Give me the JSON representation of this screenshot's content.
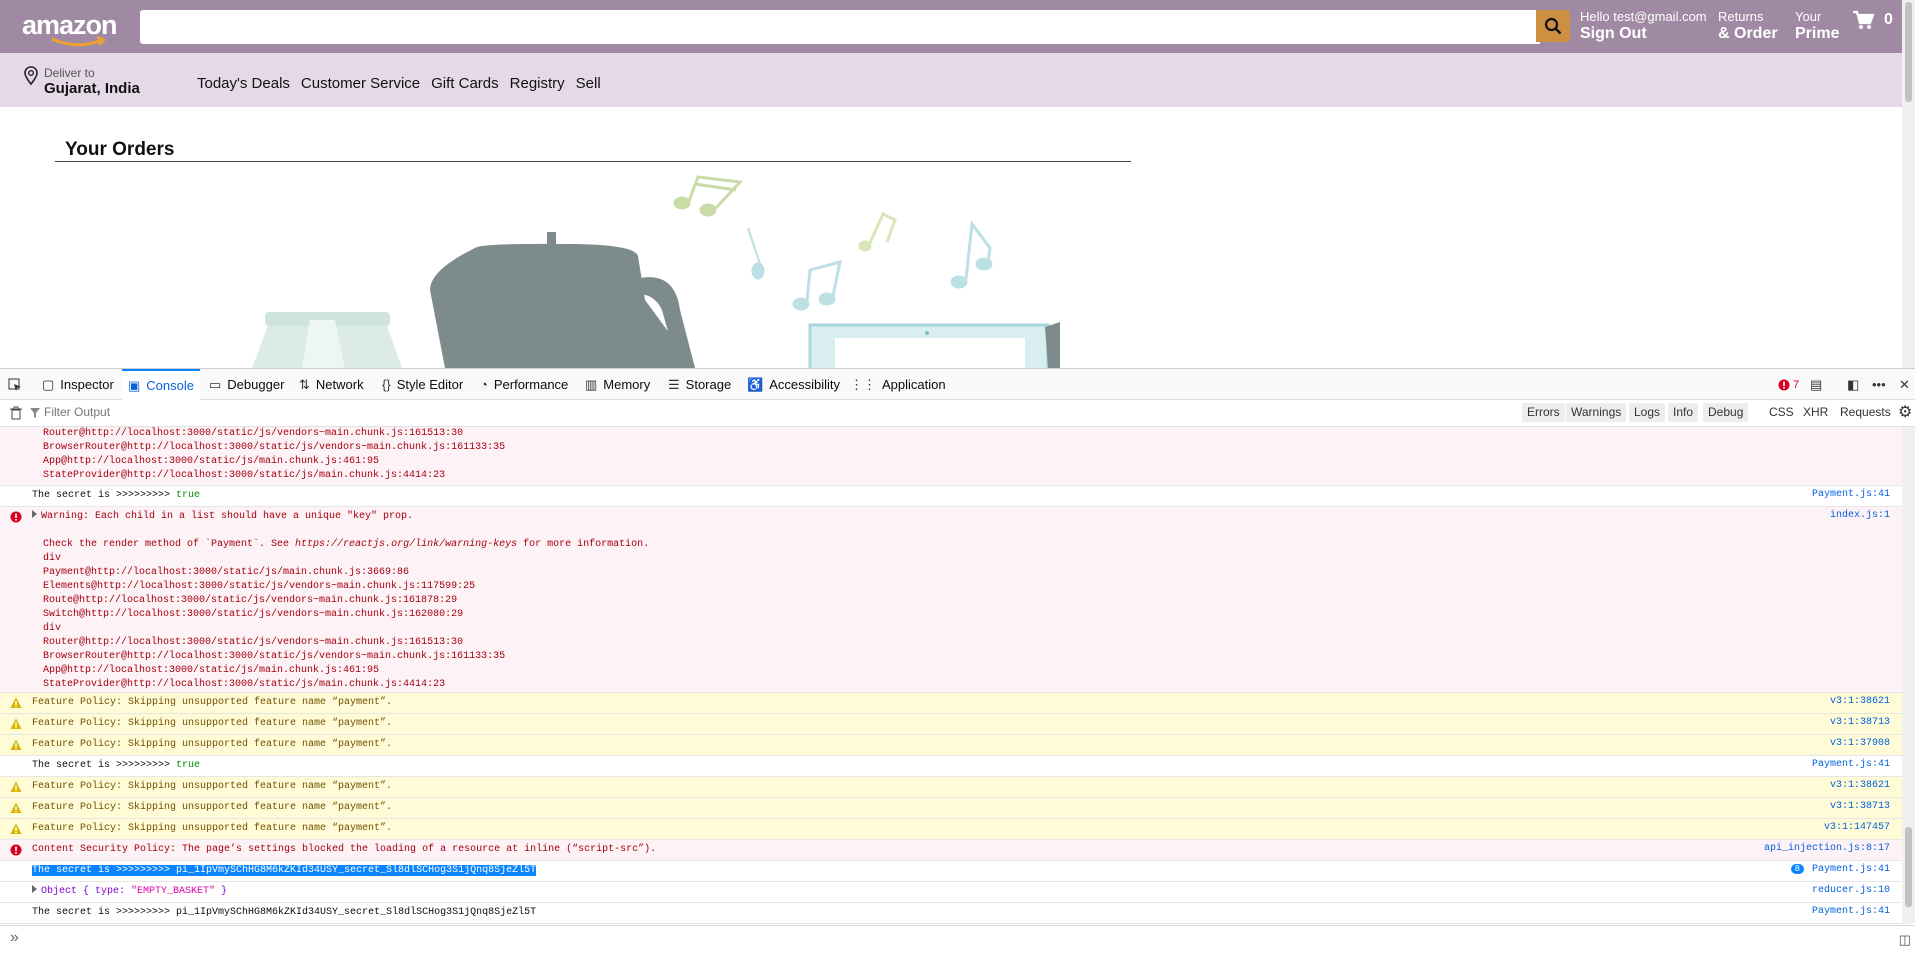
{
  "header": {
    "logo": "amazon",
    "search_placeholder": "",
    "greeting": "Hello test@gmail.com",
    "sign_out": "Sign Out",
    "returns_l1": "Returns",
    "returns_l2": "& Order",
    "prime_l1": "Your",
    "prime_l2": "Prime",
    "cart_count": "0",
    "colors": {
      "header_bg": "#a08aa3",
      "search_button": "#cd9042",
      "subnav_bg": "#e5d9e8"
    }
  },
  "subnav": {
    "deliver_l1": "Deliver to",
    "deliver_l2": "Gujarat, India",
    "links": [
      "Today's Deals",
      "Customer Service",
      "Gift Cards",
      "Registry",
      "Sell"
    ]
  },
  "orders": {
    "title": "Your Orders"
  },
  "devtools": {
    "tabs": [
      "Inspector",
      "Console",
      "Debugger",
      "Network",
      "Style Editor",
      "Performance",
      "Memory",
      "Storage",
      "Accessibility",
      "Application"
    ],
    "active_tab": "Console",
    "error_count": "7",
    "filter_placeholder": "Filter Output",
    "filters": [
      "Errors",
      "Warnings",
      "Logs",
      "Info",
      "Debug"
    ],
    "filters2": [
      "CSS",
      "XHR",
      "Requests"
    ],
    "rows": {
      "trace1": "Router@http://localhost:3000/static/js/vendors~main.chunk.js:161513:30\nBrowserRouter@http://localhost:3000/static/js/vendors~main.chunk.js:161133:35\nApp@http://localhost:3000/static/js/main.chunk.js:461:95\nStateProvider@http://localhost:3000/static/js/main.chunk.js:4414:23",
      "secret_prefix": "The secret is >>>>>>>>> ",
      "true_val": "true",
      "payment_src": "Payment.js:41",
      "warning_msg": "Warning: Each child in a list should have a unique \"key\" prop.",
      "warning_l2a": "Check the render method of `Payment`. See ",
      "warning_link": "https://reactjs.org/link/warning-keys",
      "warning_l2b": " for more information.",
      "warning_trace": "div\nPayment@http://localhost:3000/static/js/main.chunk.js:3669:86\nElements@http://localhost:3000/static/js/vendors~main.chunk.js:117599:25\nRoute@http://localhost:3000/static/js/vendors~main.chunk.js:161878:29\nSwitch@http://localhost:3000/static/js/vendors~main.chunk.js:162080:29\ndiv\nRouter@http://localhost:3000/static/js/vendors~main.chunk.js:161513:30\nBrowserRouter@http://localhost:3000/static/js/vendors~main.chunk.js:161133:35\nApp@http://localhost:3000/static/js/main.chunk.js:461:95\nStateProvider@http://localhost:3000/static/js/main.chunk.js:4414:23",
      "index_src": "index.js:1",
      "feature_policy": "Feature Policy: Skipping unsupported feature name “payment”.",
      "fp_src1": "v3:1:38621",
      "fp_src2": "v3:1:38713",
      "fp_src3": "v3:1:37908",
      "fp_src6": "v3:1:147457",
      "csp": "Content Security Policy: The page’s settings blocked the loading of a resource at inline (“script-src”).",
      "csp_src": "api_injection.js:8:17",
      "secret_full": "The secret is >>>>>>>>> pi_1IpVmySChHG8M6kZKId34USY_secret_Sl8dlSCHog3S1jQnq8SjeZl5T",
      "secret_val": "pi_1IpVmySChHG8M6kZKId34USY_secret_Sl8dlSCHog3S1jQnq8SjeZl5T",
      "repeat_badge": "8",
      "obj_prefix": "Object { type: ",
      "obj_str": "\"EMPTY_BASKET\"",
      "obj_suffix": " }",
      "reducer_src": "reducer.js:10"
    }
  }
}
